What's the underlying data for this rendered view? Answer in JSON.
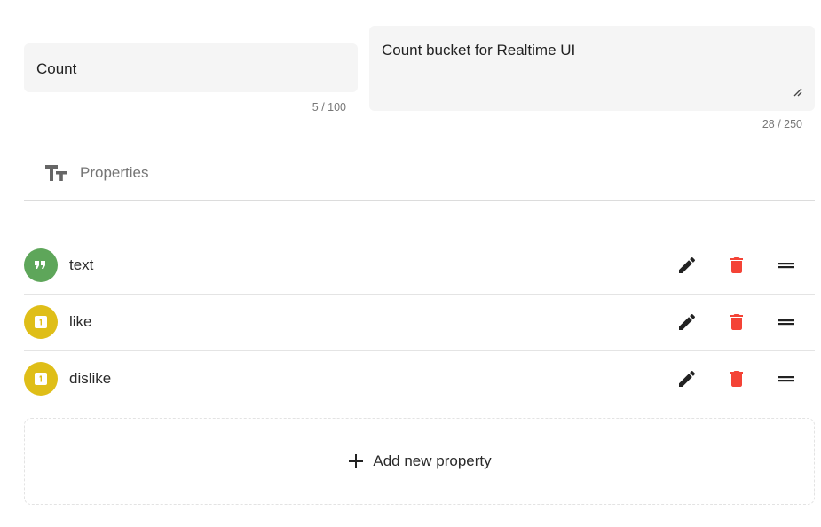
{
  "name_field": {
    "value": "Count",
    "counter": "5 / 100"
  },
  "description_field": {
    "value": "Count bucket for Realtime UI",
    "counter": "28 / 250"
  },
  "properties_section": {
    "title": "Properties",
    "icon": "text-fields-icon"
  },
  "properties": [
    {
      "name": "text",
      "type_icon": "quote-icon",
      "badge_color": "#5ea65a"
    },
    {
      "name": "like",
      "type_icon": "number-icon",
      "badge_color": "#dfbe18"
    },
    {
      "name": "dislike",
      "type_icon": "number-icon",
      "badge_color": "#dfbe18"
    }
  ],
  "actions": {
    "edit_icon": "pencil-icon",
    "delete_icon": "trash-icon",
    "drag_icon": "drag-handle-icon",
    "delete_color": "#f44336"
  },
  "add_button": {
    "label": "Add new property",
    "icon": "plus-icon"
  }
}
